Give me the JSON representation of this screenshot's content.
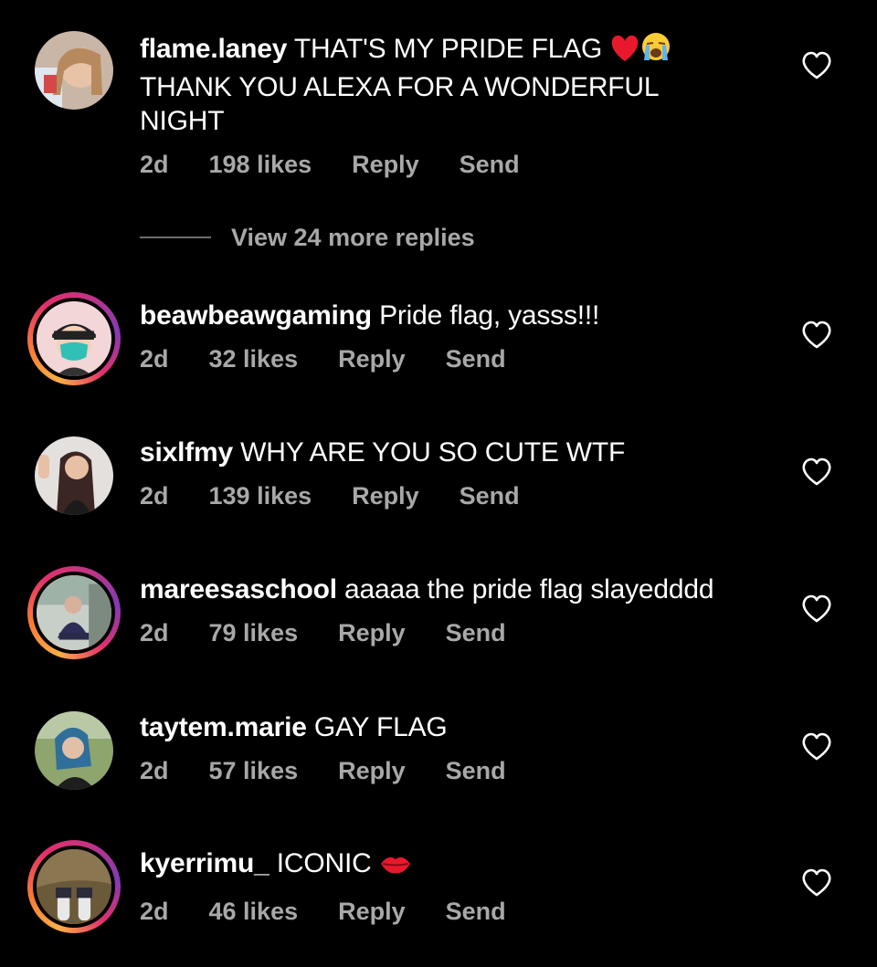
{
  "comments": [
    {
      "username": "flame.laney",
      "text": "THAT'S MY PRIDE FLAG",
      "text_line2": "THANK YOU ALEXA FOR A WONDERFUL",
      "text_line3": "NIGHT",
      "emojis": [
        "red-heart",
        "loudly-crying-face"
      ],
      "time": "2d",
      "likes": "198 likes",
      "reply": "Reply",
      "send": "Send",
      "story_ring": false
    },
    {
      "username": "beawbeawgaming",
      "text": "Pride flag, yasss!!!",
      "time": "2d",
      "likes": "32 likes",
      "reply": "Reply",
      "send": "Send",
      "story_ring": true
    },
    {
      "username": "sixlfmy",
      "text": "WHY ARE YOU SO CUTE WTF",
      "time": "2d",
      "likes": "139 likes",
      "reply": "Reply",
      "send": "Send",
      "story_ring": false
    },
    {
      "username": "mareesaschool",
      "text": "aaaaa the pride flag slayedddd",
      "time": "2d",
      "likes": "79 likes",
      "reply": "Reply",
      "send": "Send",
      "story_ring": true
    },
    {
      "username": "taytem.marie",
      "text": "GAY FLAG",
      "time": "2d",
      "likes": "57 likes",
      "reply": "Reply",
      "send": "Send",
      "story_ring": false
    },
    {
      "username": "kyerrimu_",
      "text": "ICONIC",
      "emojis": [
        "kiss-mark"
      ],
      "time": "2d",
      "likes": "46 likes",
      "reply": "Reply",
      "send": "Send",
      "story_ring": true
    }
  ],
  "view_replies": "View 24 more replies",
  "colors": {
    "background": "#000000",
    "text": "#ffffff",
    "meta": "#a8a8a8",
    "heart_emoji": "#e8192c"
  }
}
